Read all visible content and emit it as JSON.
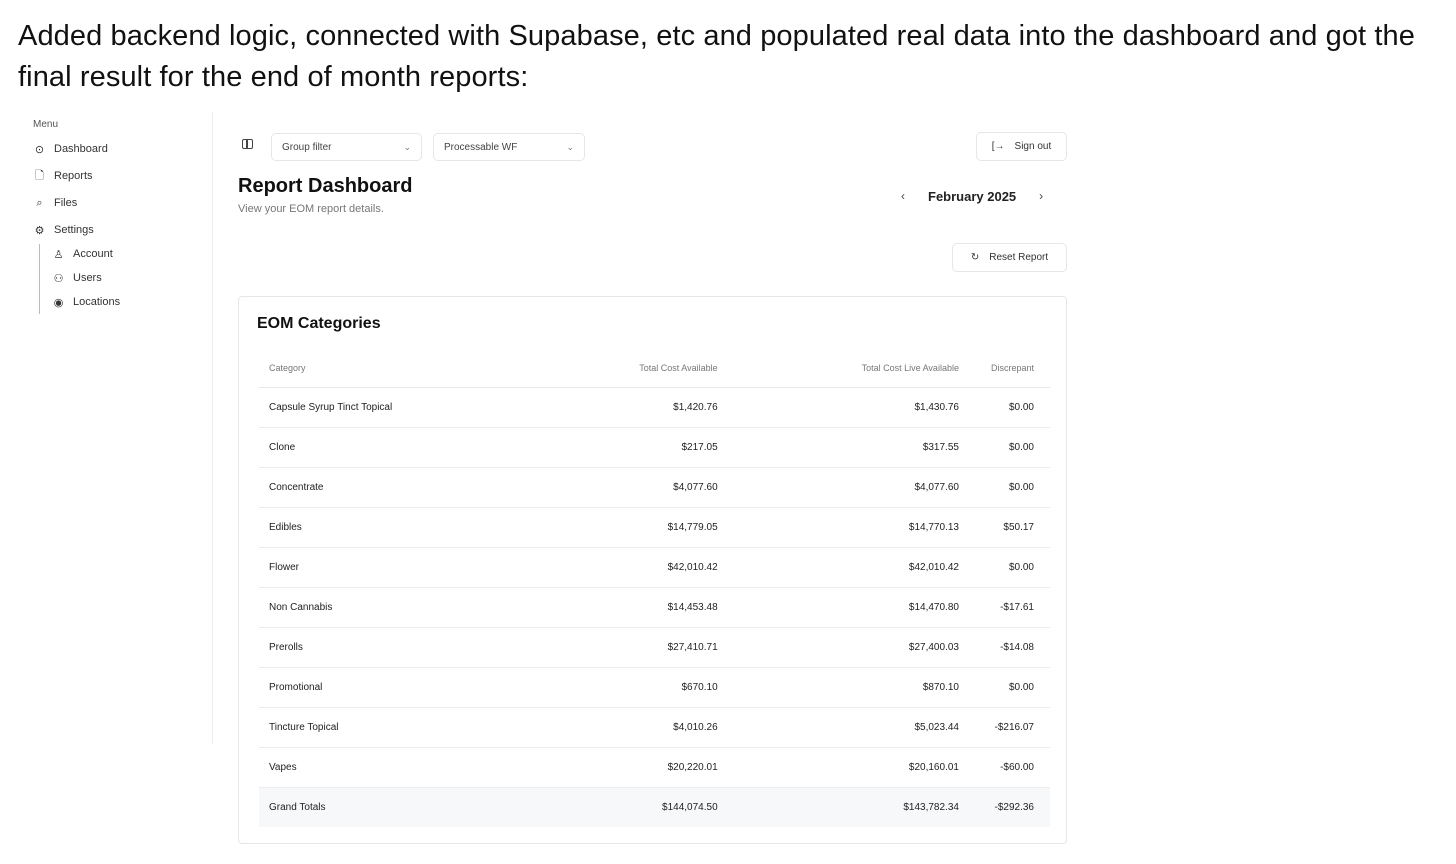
{
  "caption": "Added backend logic, connected with Supabase, etc and populated real data into the dashboard and got the final result for the end of month reports:",
  "sidebar": {
    "heading": "Menu",
    "items": [
      {
        "label": "Dashboard",
        "icon": "dashboard-icon"
      },
      {
        "label": "Reports",
        "icon": "reports-icon"
      },
      {
        "label": "Files",
        "icon": "files-icon"
      },
      {
        "label": "Settings",
        "icon": "settings-icon"
      }
    ],
    "sub_items": [
      {
        "label": "Account",
        "icon": "account-icon"
      },
      {
        "label": "Users",
        "icon": "users-icon"
      },
      {
        "label": "Locations",
        "icon": "locations-icon"
      }
    ]
  },
  "topbar": {
    "select_one": "Group filter",
    "select_two": "Processable WF",
    "signout_label": "Sign out"
  },
  "page": {
    "title": "Report Dashboard",
    "subtitle": "View your EOM report details."
  },
  "month_nav": {
    "label": "February 2025",
    "prev": "‹",
    "next": "›"
  },
  "reset_label": "Reset Report",
  "card": {
    "title": "EOM Categories",
    "columns": [
      "Category",
      "Total Cost Available",
      "Total Cost Live Available",
      "Discrepant"
    ],
    "rows": [
      [
        "Capsule Syrup Tinct Topical",
        "$1,420.76",
        "$1,430.76",
        "$0.00"
      ],
      [
        "Clone",
        "$217.05",
        "$317.55",
        "$0.00"
      ],
      [
        "Concentrate",
        "$4,077.60",
        "$4,077.60",
        "$0.00"
      ],
      [
        "Edibles",
        "$14,779.05",
        "$14,770.13",
        "$50.17"
      ],
      [
        "Flower",
        "$42,010.42",
        "$42,010.42",
        "$0.00"
      ],
      [
        "Non Cannabis",
        "$14,453.48",
        "$14,470.80",
        "-$17.61"
      ],
      [
        "Prerolls",
        "$27,410.71",
        "$27,400.03",
        "-$14.08"
      ],
      [
        "Promotional",
        "$670.10",
        "$870.10",
        "$0.00"
      ],
      [
        "Tincture Topical",
        "$4,010.26",
        "$5,023.44",
        "-$216.07"
      ],
      [
        "Vapes",
        "$20,220.01",
        "$20,160.01",
        "-$60.00"
      ],
      [
        "Grand Totals",
        "$144,074.50",
        "$143,782.34",
        "-$292.36"
      ]
    ]
  }
}
